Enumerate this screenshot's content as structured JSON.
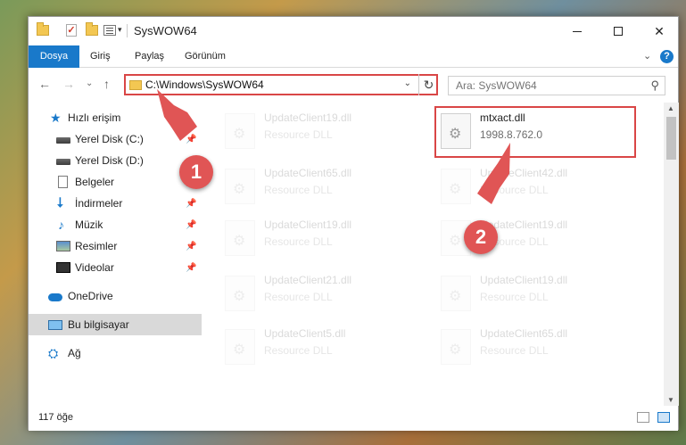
{
  "window": {
    "title": "SysWOW64",
    "controls": {
      "minimize": "minimize",
      "maximize": "maximize",
      "close": "✕"
    }
  },
  "quick_access": {
    "dropdown_glyph": "▾"
  },
  "ribbon": {
    "tabs": [
      {
        "label": "Dosya"
      },
      {
        "label": "Giriş"
      },
      {
        "label": "Paylaş"
      },
      {
        "label": "Görünüm"
      }
    ],
    "expand_glyph": "⌄",
    "help_glyph": "?"
  },
  "nav": {
    "back": "←",
    "forward": "→",
    "recent": "⌄",
    "up": "↑",
    "address": "C:\\Windows\\SysWOW64",
    "address_dropdown": "⌄",
    "refresh": "↻",
    "search_placeholder": "Ara: SysWOW64",
    "search_icon_glyph": "⚲"
  },
  "sidebar": {
    "items": [
      {
        "label": "Hızlı erişim",
        "icon": "star-icon",
        "glyph": "★",
        "pinned": false
      },
      {
        "label": "Yerel Disk (C:)",
        "icon": "drive-icon",
        "pinned": true
      },
      {
        "label": "Yerel Disk (D:)",
        "icon": "drive-icon",
        "pinned": false
      },
      {
        "label": "Belgeler",
        "icon": "document-icon",
        "pinned": true
      },
      {
        "label": "İndirmeler",
        "icon": "download-icon",
        "glyph": "⭣",
        "pinned": true
      },
      {
        "label": "Müzik",
        "icon": "music-icon",
        "glyph": "♪",
        "pinned": true
      },
      {
        "label": "Resimler",
        "icon": "pictures-icon",
        "pinned": true
      },
      {
        "label": "Videolar",
        "icon": "video-icon",
        "pinned": true
      },
      {
        "label": "OneDrive",
        "icon": "cloud-icon",
        "pinned": false
      },
      {
        "label": "Bu bilgisayar",
        "icon": "computer-icon",
        "pinned": false,
        "selected": true
      },
      {
        "label": "Ağ",
        "icon": "network-icon",
        "glyph": "⛭",
        "pinned": false
      }
    ],
    "pin_glyph": "📌"
  },
  "files": [
    {
      "name": "UpdateClient19.dll",
      "subtitle": "Resource DLL",
      "faded": true
    },
    {
      "name": "mtxact.dll",
      "subtitle": "1998.8.762.0",
      "faded": false
    },
    {
      "name": "UpdateClient65.dll",
      "subtitle": "Resource DLL",
      "faded": true
    },
    {
      "name": "UpdateClient42.dll",
      "subtitle": "Resource DLL",
      "faded": true
    },
    {
      "name": "UpdateClient19.dll",
      "subtitle": "Resource DLL",
      "faded": true
    },
    {
      "name": "UpdateClient19.dll",
      "subtitle": "Resource DLL",
      "faded": true
    },
    {
      "name": "UpdateClient21.dll",
      "subtitle": "Resource DLL",
      "faded": true
    },
    {
      "name": "UpdateClient19.dll",
      "subtitle": "Resource DLL",
      "faded": true
    },
    {
      "name": "UpdateClient5.dll",
      "subtitle": "Resource DLL",
      "faded": true
    },
    {
      "name": "UpdateClient65.dll",
      "subtitle": "Resource DLL",
      "faded": true
    }
  ],
  "file_icon_glyph": "⚙",
  "scroll": {
    "up": "▲",
    "down": "▼"
  },
  "status": {
    "count": "117 öğe"
  },
  "annotations": {
    "marker1": "1",
    "marker2": "2",
    "color": "#e05555"
  },
  "colors": {
    "accent": "#1979ca",
    "highlight": "#d94646"
  }
}
